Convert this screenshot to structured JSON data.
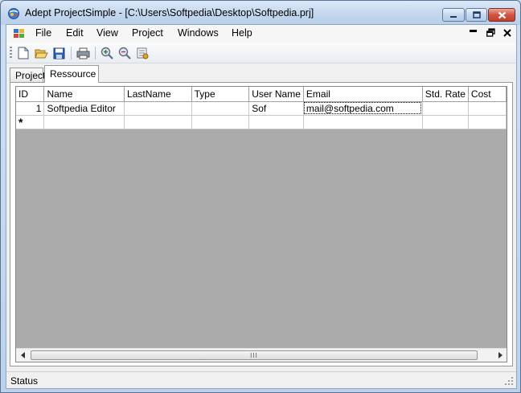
{
  "window": {
    "title": "Adept ProjectSimple - [C:\\Users\\Softpedia\\Desktop\\Softpedia.prj]"
  },
  "menu": {
    "items": [
      "File",
      "Edit",
      "View",
      "Project",
      "Windows",
      "Help"
    ]
  },
  "toolbar": {
    "buttons": [
      "new-icon",
      "open-icon",
      "save-icon",
      "print-icon",
      "zoom-in-icon",
      "zoom-out-icon",
      "properties-icon"
    ]
  },
  "tabs": [
    {
      "label": "Project",
      "active": false
    },
    {
      "label": "Ressource",
      "active": true
    }
  ],
  "grid": {
    "columns": [
      "ID",
      "Name",
      "LastName",
      "Type",
      "User Name",
      "Email",
      "Std. Rate",
      "Cost"
    ],
    "rows": [
      {
        "id": "1",
        "name": "Softpedia Editor",
        "lastname": "",
        "type": "",
        "username": "Sof",
        "email": "mail@softpedia.com",
        "std_rate": "",
        "cost": ""
      }
    ],
    "new_row_marker": "*"
  },
  "scrollbar": {
    "thumb_grip": "III"
  },
  "status": {
    "text": "Status"
  },
  "colors": {
    "grid_background": "#ababab",
    "title_gradient_top": "#dbe8f6",
    "close_button": "#d2533f"
  }
}
